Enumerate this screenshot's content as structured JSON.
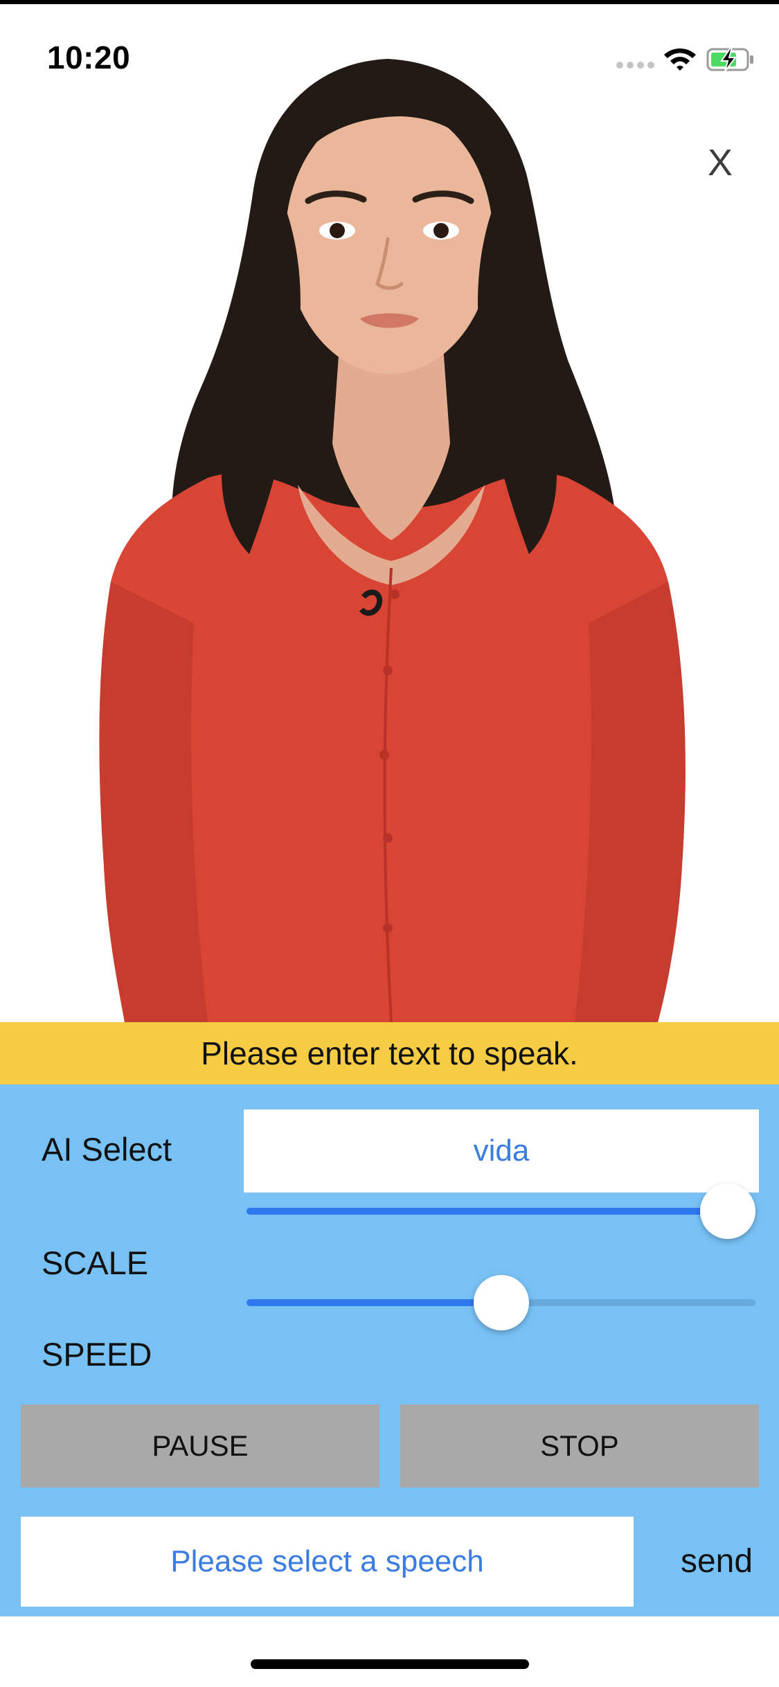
{
  "status_bar": {
    "time": "10:20"
  },
  "close_label": "X",
  "banner": {
    "text": "Please enter text to speak."
  },
  "controls": {
    "ai_select_label": "AI Select",
    "ai_select_value": "vida",
    "scale_label": "SCALE",
    "scale_value": 1.0,
    "speed_label": "SPEED",
    "speed_value": 0.5,
    "pause_label": "PAUSE",
    "stop_label": "STOP",
    "speech_placeholder": "Please select a speech",
    "send_label": "send"
  },
  "colors": {
    "banner": "#f6cc44",
    "panel": "#78c1f4",
    "accent_blue": "#2f78ee",
    "button_gray": "#a9a9a9",
    "cardigan_red": "#d84535"
  },
  "icons": [
    "cellular-signal-icon",
    "wifi-icon",
    "battery-charging-icon",
    "close-icon",
    "avatar-figure"
  ]
}
